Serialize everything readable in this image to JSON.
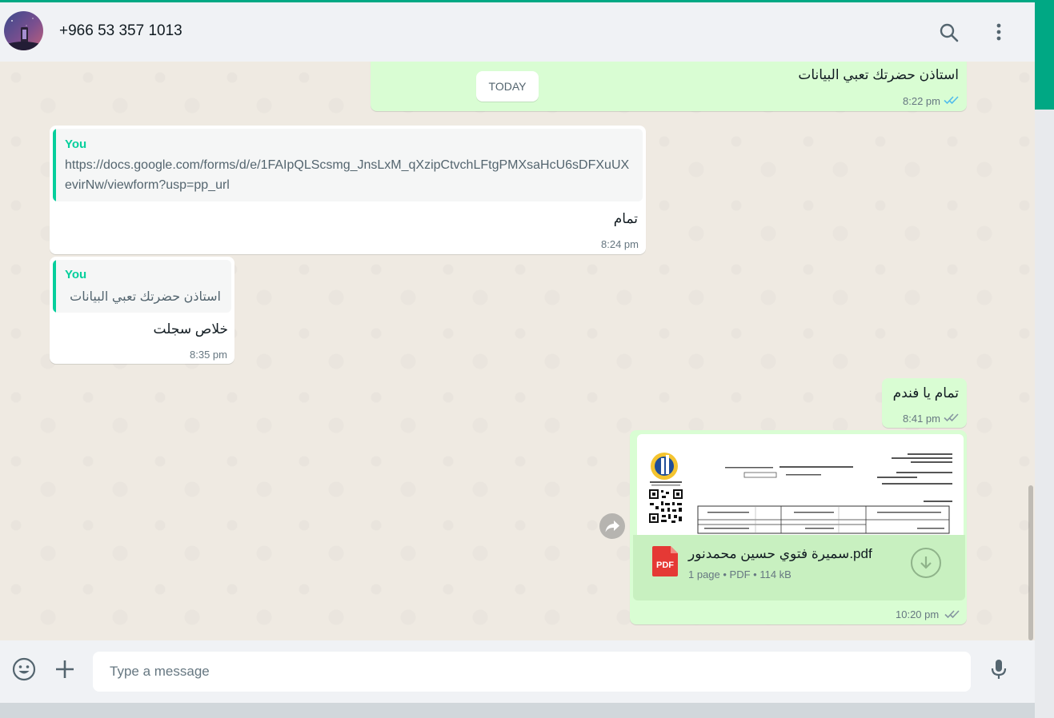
{
  "header": {
    "contact": "+966 53 357 1013"
  },
  "chat": {
    "date_label": "TODAY",
    "messages": [
      {
        "text": "استاذن حضرتك تعبي البيانات",
        "time": "8:22 pm"
      },
      {
        "quote_author": "You",
        "quote_line1": "https://docs.google.com/forms/d/e/1FAIpQLScsmg_JnsLxM_qXzipCtvchLFtgPMXsaHcU6sDFXuUX",
        "quote_line2": "evirNw/viewform?usp=pp_url",
        "text": "تمام",
        "time": "8:24 pm"
      },
      {
        "quote_author": "You",
        "quote_text": "استاذن حضرتك تعبي البيانات",
        "text": "خلاص سجلت",
        "time": "8:35 pm"
      },
      {
        "text": "تمام يا فندم",
        "time": "8:41 pm"
      },
      {
        "doc_name": "سميرة فتوي حسين محمدنور.pdf",
        "doc_pages": "1 page",
        "doc_type": "PDF",
        "doc_size": "114 kB",
        "pdf_badge": "PDF",
        "time": "10:20 pm"
      }
    ]
  },
  "composer": {
    "placeholder": "Type a message"
  },
  "icons": {
    "search": "search-icon",
    "menu": "menu-dots-icon",
    "emoji": "emoji-icon",
    "attach": "plus-icon",
    "mic": "microphone-icon",
    "forward": "forward-icon",
    "download": "download-icon"
  },
  "colors": {
    "accent": "#00a884",
    "outgoing": "#d9fdd3",
    "incoming": "#ffffff",
    "quote_author": "#06cf9c",
    "read_ticks": "#53bdeb",
    "pdf_red": "#e53935"
  }
}
